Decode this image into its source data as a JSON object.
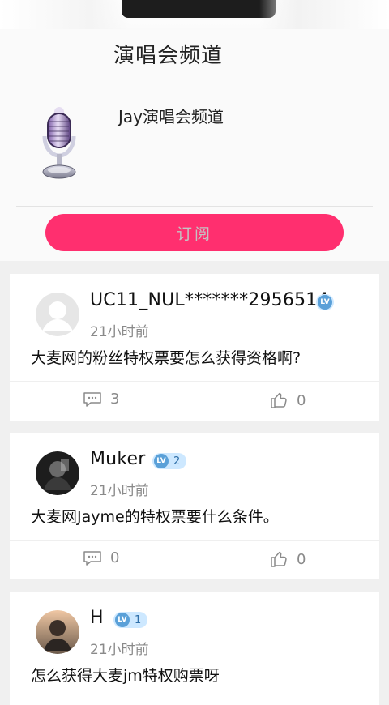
{
  "header": {
    "title": "演唱会频道"
  },
  "channel": {
    "name": "Jay演唱会频道",
    "subscribe_label": "订阅",
    "icon": "microphone-icon"
  },
  "posts": [
    {
      "username": "UC11_NUL*******2956514",
      "level": "",
      "time": "21小时前",
      "content": "大麦网的粉丝特权票要怎么获得资格啊?",
      "comments": "3",
      "likes": "0"
    },
    {
      "username": "Muker",
      "level": "2",
      "time": "21小时前",
      "content": "大麦网Jayme的特权票要什么条件。",
      "comments": "0",
      "likes": "0"
    },
    {
      "username": "H",
      "level": "1",
      "time": "21小时前",
      "content": "怎么获得大麦jm特权购票呀"
    }
  ],
  "badge_text": "LV",
  "colors": {
    "accent": "#ff2f6f",
    "badge": "#5aa0d8"
  }
}
